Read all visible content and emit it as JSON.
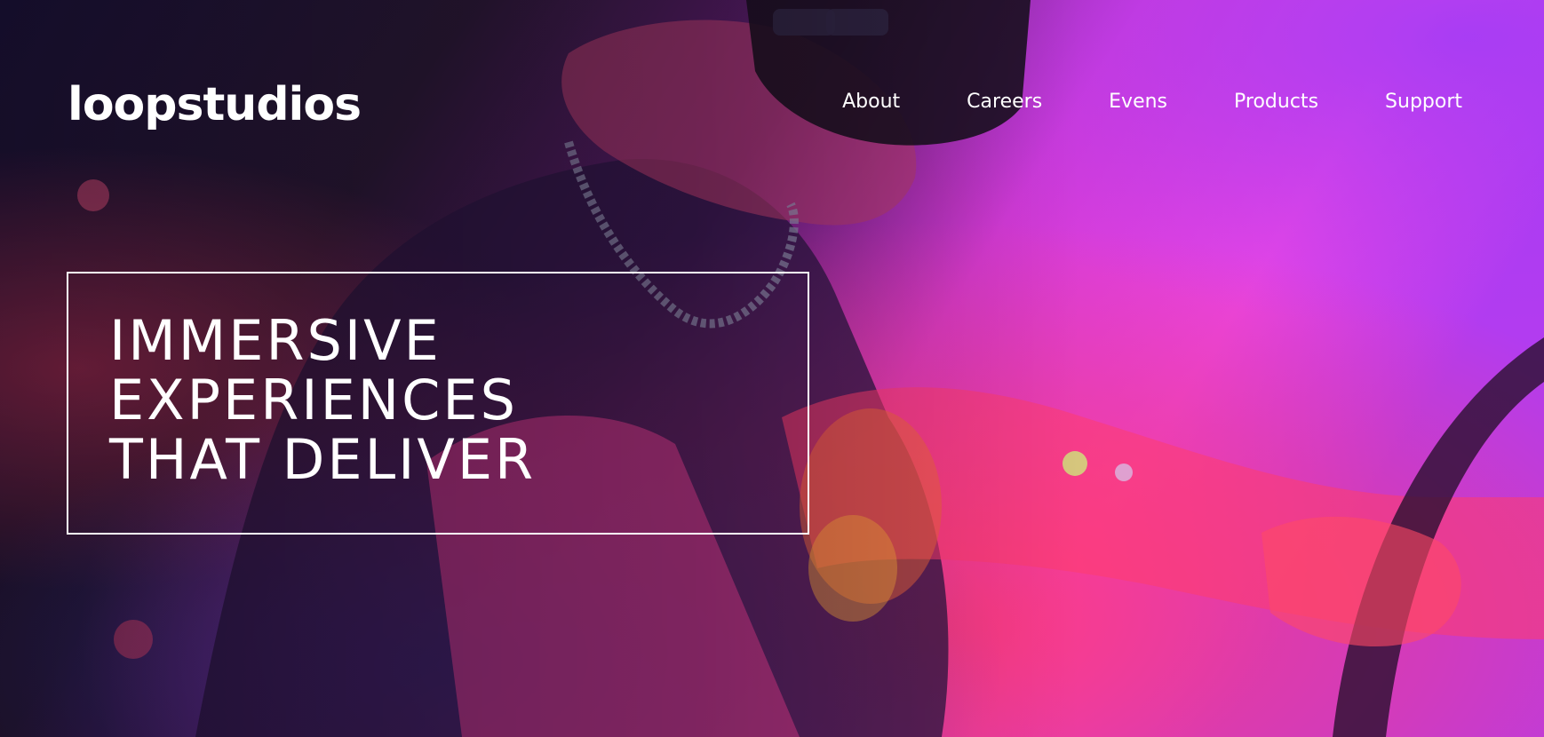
{
  "brand": {
    "name": "loopstudios"
  },
  "nav": {
    "items": [
      {
        "label": "About"
      },
      {
        "label": "Careers"
      },
      {
        "label": "Evens"
      },
      {
        "label": "Products"
      },
      {
        "label": "Support"
      }
    ]
  },
  "hero": {
    "headline_lines": [
      "IMMERSIVE",
      "EXPERIENCES",
      "THAT DELIVER"
    ],
    "image_subject": "person-wearing-vr-headset-neon-pink-blue"
  },
  "colors": {
    "text": "#ffffff",
    "magenta": "#e63ce0",
    "hot_pink": "#ff2f7a",
    "violet": "#b03df2",
    "deep_blue": "#2b2ad9",
    "dark_overlay": "#1a1130"
  }
}
